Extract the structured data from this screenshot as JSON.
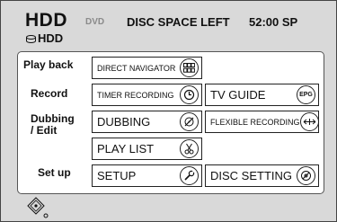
{
  "header": {
    "title": "HDD",
    "dvd_label": "DVD",
    "disc_space_label": "DISC SPACE LEFT",
    "disc_space_value": "52:00 SP",
    "drive_label": "HDD"
  },
  "rows": {
    "playback": "Play back",
    "record": "Record",
    "dubbing_line1": "Dubbing",
    "dubbing_line2": "/ Edit",
    "setup": "Set up"
  },
  "buttons": {
    "direct_navigator": "DIRECT NAVIGATOR",
    "timer_recording": "TIMER RECORDING",
    "tv_guide": "TV GUIDE",
    "dubbing": "DUBBING",
    "flexible_recording": "FLEXIBLE RECORDING",
    "play_list": "PLAY LIST",
    "setup": "SETUP",
    "disc_setting": "DISC SETTING"
  },
  "icons": {
    "direct_navigator": "grid-icon",
    "timer_recording": "clock-icon",
    "tv_guide": "epg-icon",
    "tv_guide_text": "EPG",
    "dubbing": "dubbing-disc-icon",
    "flexible_recording": "flexible-rec-icon",
    "play_list": "scissors-icon",
    "setup": "wrench-icon",
    "disc_setting": "disc-icon",
    "footer": "navigation-cursor-icon"
  }
}
